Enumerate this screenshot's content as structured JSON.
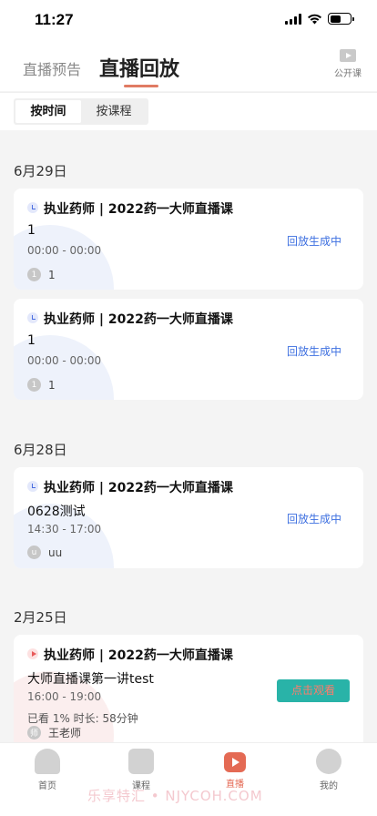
{
  "status_bar": {
    "time": "11:27"
  },
  "header": {
    "tab_preview": "直播预告",
    "tab_replay": "直播回放",
    "public_label": "公开课"
  },
  "filter": {
    "by_time": "按时间",
    "by_course": "按课程"
  },
  "sections": [
    {
      "date": "6月29日",
      "cards": [
        {
          "course": "执业药师 | 2022药一大师直播课",
          "lesson": "1",
          "time": "00:00 - 00:00",
          "teacher": "1",
          "avatar": "1",
          "status": "回放生成中"
        },
        {
          "course": "执业药师 | 2022药一大师直播课",
          "lesson": "1",
          "time": "00:00 - 00:00",
          "teacher": "1",
          "avatar": "1",
          "status": "回放生成中"
        }
      ]
    },
    {
      "date": "6月28日",
      "cards": [
        {
          "course": "执业药师 | 2022药一大师直播课",
          "lesson": "0628测试",
          "time": "14:30 - 17:00",
          "teacher": "uu",
          "avatar": "u",
          "status": "回放生成中"
        }
      ]
    },
    {
      "date": "2月25日",
      "cards": [
        {
          "course": "执业药师 | 2022药一大师直播课",
          "lesson": "大师直播课第一讲test",
          "time": "16:00 - 19:00",
          "progress": "已看 1%  时长: 58分钟",
          "teacher": "王老师",
          "avatar": "师",
          "button": "点击观看"
        }
      ]
    }
  ],
  "tab_bar": {
    "home": "首页",
    "course": "课程",
    "live": "直播",
    "mine": "我的"
  },
  "watermark": "乐享特汇 • NJYCOH.COM"
}
